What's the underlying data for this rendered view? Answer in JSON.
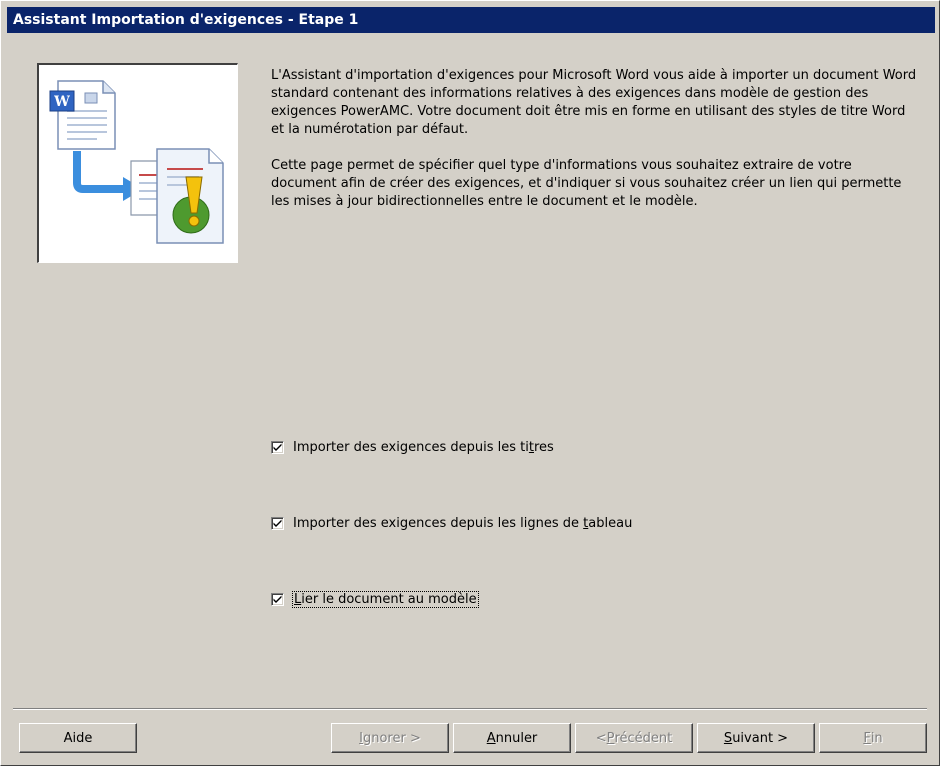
{
  "window": {
    "title": "Assistant Importation d'exigences - Etape 1"
  },
  "description": {
    "paragraph1": "L'Assistant d'importation d'exigences pour Microsoft Word vous aide à importer un document Word standard contenant des informations relatives à des exigences dans modèle de gestion des exigences PowerAMC. Votre document doit être mis en forme en utilisant des styles de titre Word et la numérotation par défaut.",
    "paragraph2": "Cette page permet de spécifier quel type d'informations vous souhaitez extraire de votre document afin de créer des exigences, et d'indiquer si vous souhaitez créer un lien qui permette les mises à jour bidirectionnelles entre le document et le modèle."
  },
  "options": {
    "import_titles": {
      "pre": "Importer des exigences depuis les ti",
      "acc": "t",
      "post": "res",
      "checked": true
    },
    "import_table_rows": {
      "pre": "Importer des exigences depuis les lignes de ",
      "acc": "t",
      "post": "ableau",
      "checked": true
    },
    "link_document": {
      "pre": "",
      "acc": "L",
      "post": "ier le document au modèle",
      "checked": true
    }
  },
  "buttons": {
    "help": {
      "label": "Aide",
      "enabled": true
    },
    "skip": {
      "pre": "",
      "acc": "I",
      "post": "gnorer >",
      "enabled": false
    },
    "cancel": {
      "pre": "",
      "acc": "A",
      "post": "nnuler",
      "enabled": true
    },
    "previous": {
      "pre": "< ",
      "acc": "P",
      "post": "récédent",
      "enabled": false
    },
    "next": {
      "pre": "",
      "acc": "S",
      "post": "uivant >",
      "enabled": true
    },
    "finish": {
      "pre": "",
      "acc": "F",
      "post": "in",
      "enabled": false
    }
  },
  "icons": {
    "word_document": "word-document-icon",
    "arrow": "arrow-right-icon",
    "requirement_document": "requirement-document-icon",
    "check": "checkmark-icon"
  },
  "colors": {
    "title_bar": "#0a246a",
    "dialog_background": "#d4d0c8",
    "arrow": "#3b8ede"
  }
}
